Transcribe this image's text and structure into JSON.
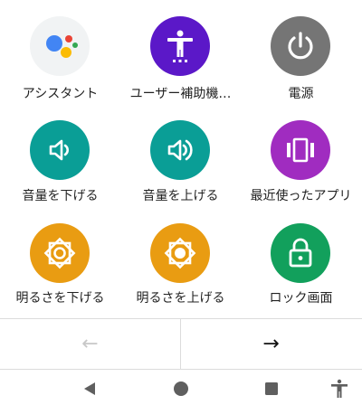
{
  "tiles": [
    {
      "label": "アシスタント",
      "icon": "google-assistant-icon",
      "color": "#f1f3f4"
    },
    {
      "label": "ユーザー補助機…",
      "icon": "accessibility-person-icon",
      "color": "#5b18c8"
    },
    {
      "label": "電源",
      "icon": "power-icon",
      "color": "#757575"
    },
    {
      "label": "音量を下げる",
      "icon": "volume-down-icon",
      "color": "#0a9e96"
    },
    {
      "label": "音量を上げる",
      "icon": "volume-up-icon",
      "color": "#0a9e96"
    },
    {
      "label": "最近使ったアプリ",
      "icon": "recent-apps-icon",
      "color": "#a02cc0"
    },
    {
      "label": "明るさを下げる",
      "icon": "brightness-down-icon",
      "color": "#e99c12"
    },
    {
      "label": "明るさを上げる",
      "icon": "brightness-up-icon",
      "color": "#e99c12"
    },
    {
      "label": "ロック画面",
      "icon": "lock-icon",
      "color": "#12a05c"
    }
  ],
  "nav": {
    "prev_glyph": "←",
    "next_glyph": "→"
  },
  "system_nav": {
    "back": "back-triangle-icon",
    "home": "home-circle-icon",
    "recents": "recents-square-icon",
    "accessibility": "accessibility-icon"
  }
}
